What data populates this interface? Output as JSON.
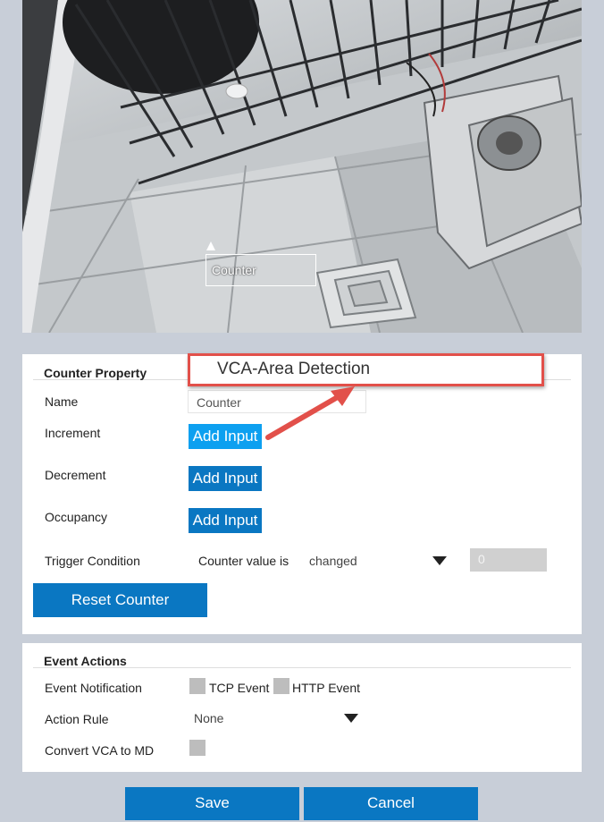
{
  "camera": {
    "overlay_label": "Counter"
  },
  "callout": {
    "text": "VCA-Area Detection"
  },
  "counter_property": {
    "title": "Counter Property",
    "name_label": "Name",
    "name_value": "Counter",
    "increment_label": "Increment",
    "decrement_label": "Decrement",
    "occupancy_label": "Occupancy",
    "add_input_label": "Add Input",
    "trigger_label": "Trigger Condition",
    "trigger_prefix": "Counter value is",
    "trigger_select": "changed",
    "trigger_value": "0",
    "reset_button": "Reset Counter"
  },
  "event_actions": {
    "title": "Event Actions",
    "notification_label": "Event Notification",
    "tcp_label": "TCP Event",
    "http_label": "HTTP Event",
    "action_rule_label": "Action Rule",
    "action_rule_value": "None",
    "convert_label": "Convert VCA to MD"
  },
  "footer": {
    "save": "Save",
    "cancel": "Cancel"
  },
  "colors": {
    "accent": "#0a77c2",
    "active": "#0da0f0",
    "callout_border": "#e2504a",
    "page_bg": "#c8ced8"
  }
}
